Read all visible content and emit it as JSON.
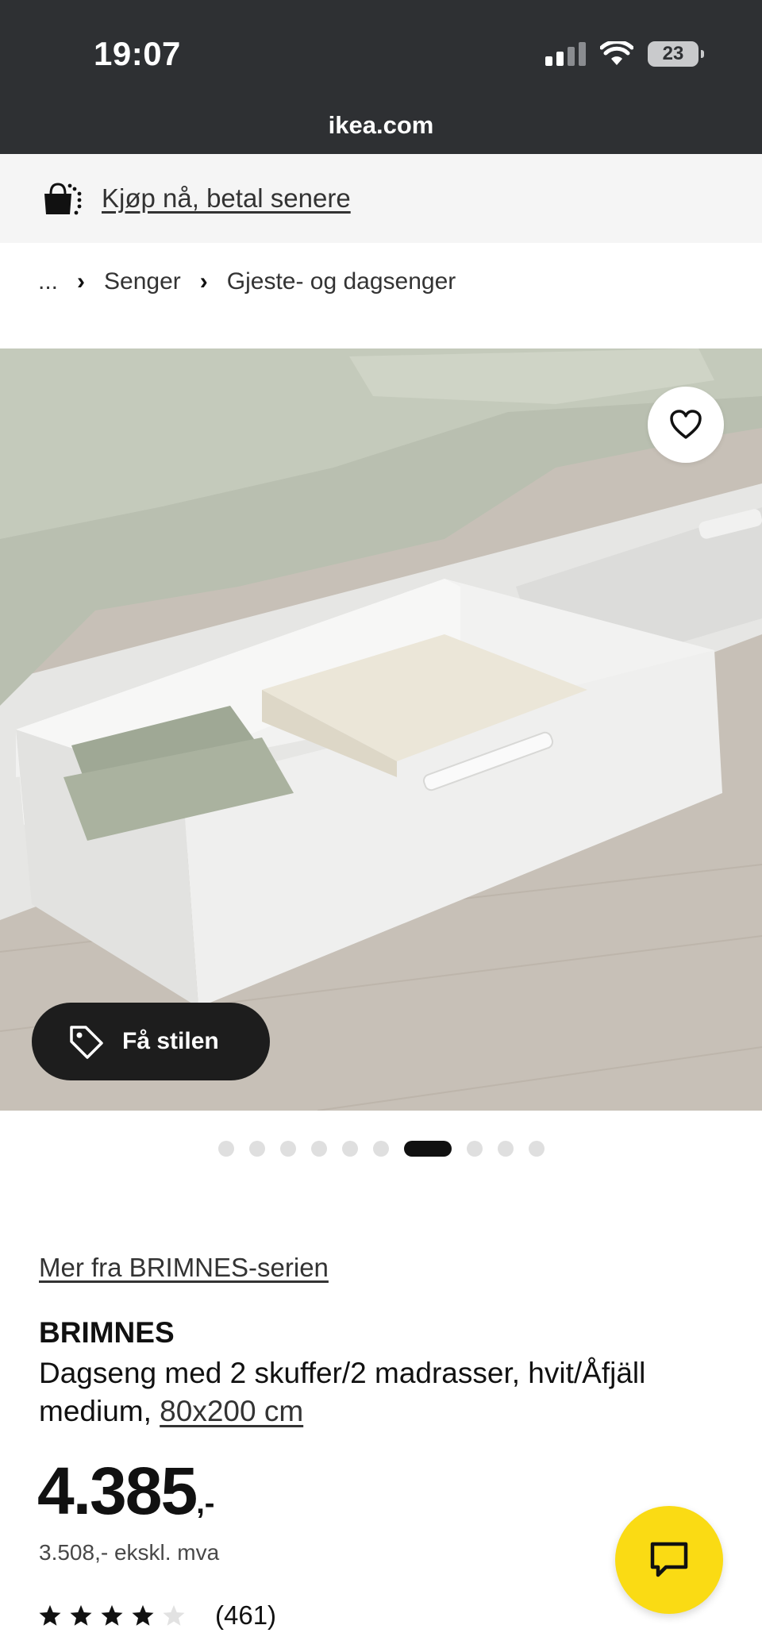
{
  "status_bar": {
    "time": "19:07",
    "battery": "23"
  },
  "browser": {
    "url": "ikea.com"
  },
  "banner": {
    "label": "Kjøp nå, betal senere"
  },
  "breadcrumb": {
    "ellipsis": "...",
    "items": [
      "Senger",
      "Gjeste- og dagsenger"
    ]
  },
  "gallery": {
    "style_button_label": "Få stilen",
    "image_count": 10,
    "active_index": 6
  },
  "product": {
    "series_link": "Mer fra BRIMNES-serien",
    "name": "BRIMNES",
    "description": "Dagseng med 2 skuffer/2 madrasser, hvit/Åfjäll medium,",
    "size": "80x200 cm",
    "price": "4.385",
    "price_suffix": ",-",
    "price_excl_vat": "3.508,- ekskl. mva",
    "rating": 4,
    "rating_max": 5,
    "rating_count": "(461)"
  },
  "colors": {
    "topbar": "#2e3033",
    "chat_button": "#fadb14"
  }
}
